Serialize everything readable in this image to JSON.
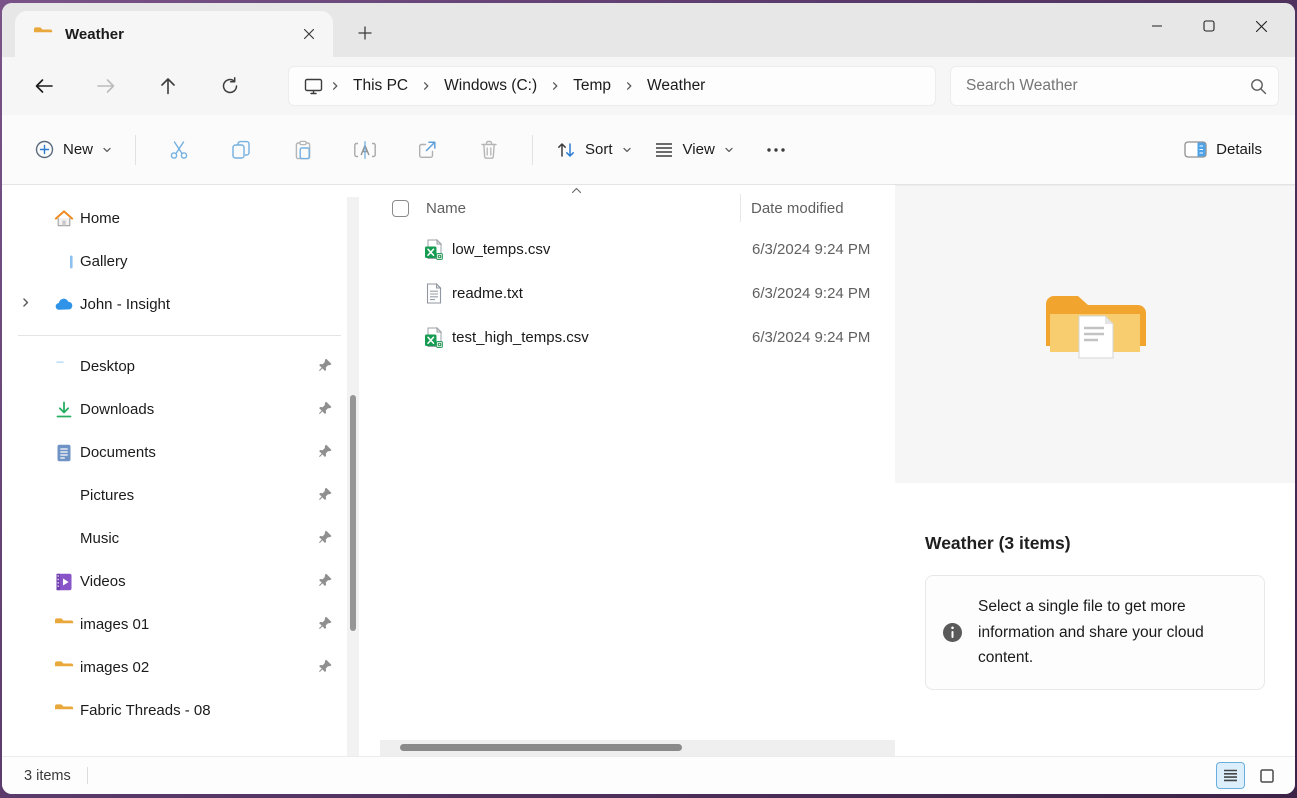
{
  "tab": {
    "title": "Weather"
  },
  "breadcrumb": {
    "items": [
      "This PC",
      "Windows (C:)",
      "Temp",
      "Weather"
    ]
  },
  "search": {
    "placeholder": "Search Weather"
  },
  "toolbar": {
    "new_label": "New",
    "sort_label": "Sort",
    "view_label": "View",
    "details_label": "Details"
  },
  "sidebar": {
    "top": [
      {
        "label": "Home"
      },
      {
        "label": "Gallery"
      },
      {
        "label": "John - Insight"
      }
    ],
    "items": [
      {
        "label": "Desktop",
        "pinned": true
      },
      {
        "label": "Downloads",
        "pinned": true
      },
      {
        "label": "Documents",
        "pinned": true
      },
      {
        "label": "Pictures",
        "pinned": true
      },
      {
        "label": "Music",
        "pinned": true
      },
      {
        "label": "Videos",
        "pinned": true
      },
      {
        "label": "images 01",
        "pinned": true
      },
      {
        "label": "images 02",
        "pinned": true
      },
      {
        "label": "Fabric Threads - 08",
        "pinned": false
      }
    ]
  },
  "files": {
    "columns": {
      "name": "Name",
      "date": "Date modified"
    },
    "rows": [
      {
        "name": "low_temps.csv",
        "type": "csv",
        "date": "6/3/2024 9:24 PM"
      },
      {
        "name": "readme.txt",
        "type": "txt",
        "date": "6/3/2024 9:24 PM"
      },
      {
        "name": "test_high_temps.csv",
        "type": "csv",
        "date": "6/3/2024 9:24 PM"
      }
    ]
  },
  "details_panel": {
    "title": "Weather (3 items)",
    "info_text": "Select a single file to get more information and share your cloud content."
  },
  "statusbar": {
    "count": "3 items"
  },
  "colors": {
    "accent_blue": "#2b7cd3",
    "folder_gold": "#fcc238",
    "excel_green": "#107c41",
    "frame_purple": "#5a3a6b"
  }
}
